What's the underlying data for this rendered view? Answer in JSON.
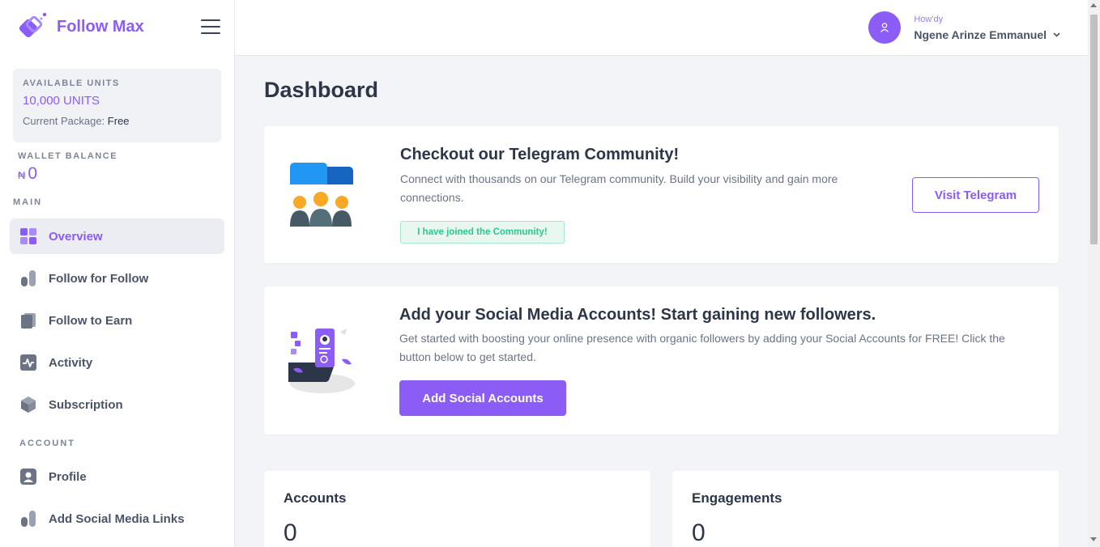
{
  "brand": {
    "name": "Follow Max"
  },
  "units": {
    "label": "AVAILABLE UNITS",
    "value": "10,000 UNITS",
    "package_prefix": "Current Package:",
    "package_value": "Free"
  },
  "wallet": {
    "label": "WALLET BALANCE",
    "currency": "₦",
    "value": "0"
  },
  "sidebar": {
    "main_label": "MAIN",
    "account_label": "ACCOUNT",
    "items": [
      {
        "label": "Overview",
        "icon": "grid-icon",
        "active": true
      },
      {
        "label": "Follow for Follow",
        "icon": "bar-chart-icon"
      },
      {
        "label": "Follow to Earn",
        "icon": "cards-icon"
      },
      {
        "label": "Activity",
        "icon": "activity-icon"
      },
      {
        "label": "Subscription",
        "icon": "box-icon"
      },
      {
        "label": "Profile",
        "icon": "user-square-icon"
      },
      {
        "label": "Add Social Media Links",
        "icon": "bar-chart-icon"
      }
    ]
  },
  "header": {
    "greeting": "How'dy",
    "user_name": "Ngene Arinze Emmanuel"
  },
  "page": {
    "title": "Dashboard"
  },
  "telegram": {
    "title": "Checkout our Telegram Community!",
    "text": "Connect with thousands on our Telegram community. Build your visibility and gain more connections.",
    "badge": "I have joined the Community!",
    "button": "Visit Telegram"
  },
  "social": {
    "title": "Add your Social Media Accounts! Start gaining new followers.",
    "text": "Get started with boosting your online presence with organic followers by adding your Social Accounts for FREE! Click the button below to get started.",
    "button": "Add Social Accounts"
  },
  "stats": [
    {
      "title": "Accounts",
      "value": "0"
    },
    {
      "title": "Engagements",
      "value": "0"
    }
  ],
  "colors": {
    "accent": "#8b5cf6",
    "success": "#2bc88f",
    "text": "#2d3548",
    "muted": "#6b7385"
  }
}
